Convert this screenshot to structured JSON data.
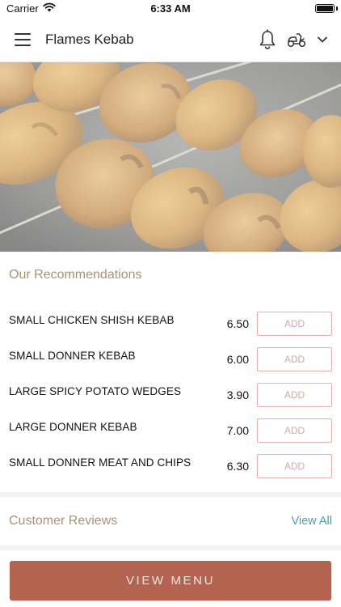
{
  "status_bar": {
    "carrier": "Carrier",
    "time": "6:33 AM"
  },
  "header": {
    "title": "Flames Kebab"
  },
  "recommendations": {
    "title": "Our Recommendations",
    "items": [
      {
        "name": "SMALL CHICKEN SHISH KEBAB",
        "price": "6.50",
        "add_label": "ADD"
      },
      {
        "name": "SMALL DONNER KEBAB",
        "price": "6.00",
        "add_label": "ADD"
      },
      {
        "name": "LARGE SPICY POTATO WEDGES",
        "price": "3.90",
        "add_label": "ADD"
      },
      {
        "name": "LARGE DONNER KEBAB",
        "price": "7.00",
        "add_label": "ADD"
      },
      {
        "name": "SMALL DONNER MEAT AND CHIPS",
        "price": "6.30",
        "add_label": "ADD"
      }
    ]
  },
  "reviews": {
    "title": "Customer Reviews",
    "view_all_label": "View All"
  },
  "footer": {
    "view_menu_label": "VIEW MENU"
  },
  "colors": {
    "accent": "#b4634f",
    "section_title": "#a99274",
    "link": "#4b9bc2",
    "add_border": "#e6b0aa"
  },
  "icons": [
    "wifi-icon",
    "battery-icon",
    "hamburger-menu-icon",
    "bell-icon",
    "scooter-icon",
    "chevron-down-icon"
  ]
}
